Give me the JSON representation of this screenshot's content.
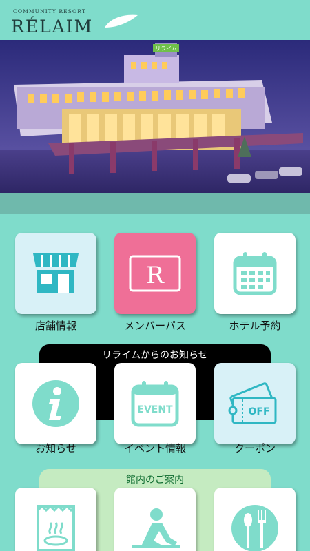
{
  "brand": {
    "tagline": "COMMUNITY RESORT",
    "name": "RÉLAIM"
  },
  "hero": {
    "sign": "リライム"
  },
  "menu": {
    "row1": [
      {
        "label": "店舗情報",
        "icon": "shop-icon"
      },
      {
        "label": "メンバーパス",
        "icon": "member-pass-icon",
        "icon_text": "R"
      },
      {
        "label": "ホテル予約",
        "icon": "calendar-icon"
      }
    ],
    "news_header": "リライムからのお知らせ",
    "row2": [
      {
        "label": "お知らせ",
        "icon": "info-icon"
      },
      {
        "label": "イベント情報",
        "icon": "event-calendar-icon",
        "icon_text": "EVENT"
      },
      {
        "label": "クーポン",
        "icon": "coupon-icon",
        "icon_text": "OFF"
      }
    ],
    "guide_header": "館内のご案内",
    "row3": [
      {
        "icon": "hot-spring-icon"
      },
      {
        "icon": "fitness-icon"
      },
      {
        "icon": "restaurant-icon"
      }
    ]
  },
  "colors": {
    "background": "#7fdccb",
    "accent": "#2fb7c3",
    "member_pink": "#ef6f97",
    "news_bar": "#000000",
    "guide_bar": "#c5ebc1"
  }
}
